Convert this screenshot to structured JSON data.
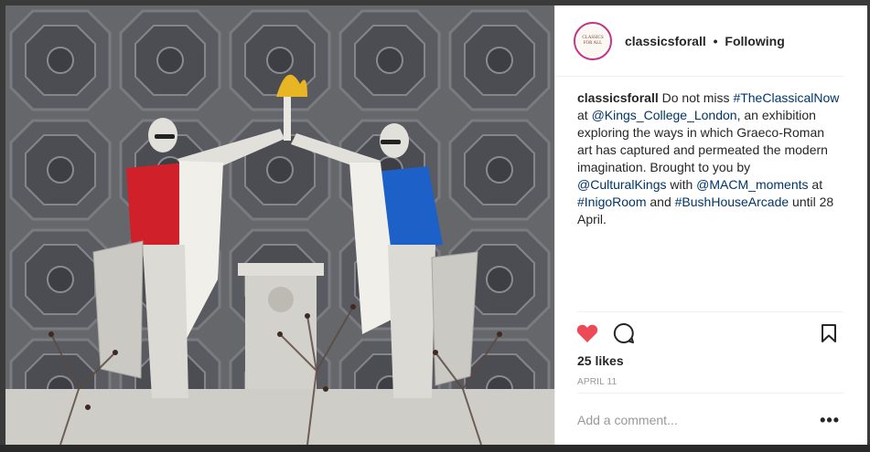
{
  "post": {
    "username": "classicsforall",
    "separator": "•",
    "follow_status": "Following",
    "avatar_text": "CLASSICS FOR ALL",
    "caption_parts": [
      {
        "t": "classicsforall",
        "k": "user"
      },
      {
        "t": " Do not miss ",
        "k": "text"
      },
      {
        "t": "#TheClassicalNow",
        "k": "link"
      },
      {
        "t": " at ",
        "k": "text"
      },
      {
        "t": "@Kings_College_London",
        "k": "link"
      },
      {
        "t": ", an exhibition exploring the ways in which Graeco-Roman art has captured and permeated the modern imagination. Brought to you by ",
        "k": "text"
      },
      {
        "t": "@CulturalKings",
        "k": "link"
      },
      {
        "t": " with ",
        "k": "text"
      },
      {
        "t": "@MACM_moments",
        "k": "link"
      },
      {
        "t": " at ",
        "k": "text"
      },
      {
        "t": "#InigoRoom",
        "k": "link"
      },
      {
        "t": " and ",
        "k": "text"
      },
      {
        "t": "#BushHouseArcade",
        "k": "link"
      },
      {
        "t": " until 28 April.",
        "k": "text"
      }
    ],
    "likes": "25 likes",
    "date": "APRIL 11",
    "comment_placeholder": "Add a comment...",
    "more_glyph": "•••"
  },
  "icons": {
    "like": "heart-icon",
    "comment": "comment-icon",
    "save": "bookmark-icon",
    "more": "more-options-icon"
  },
  "colors": {
    "like_red": "#ed4956",
    "link_blue": "#003569",
    "avatar_ring": "#c13584"
  }
}
